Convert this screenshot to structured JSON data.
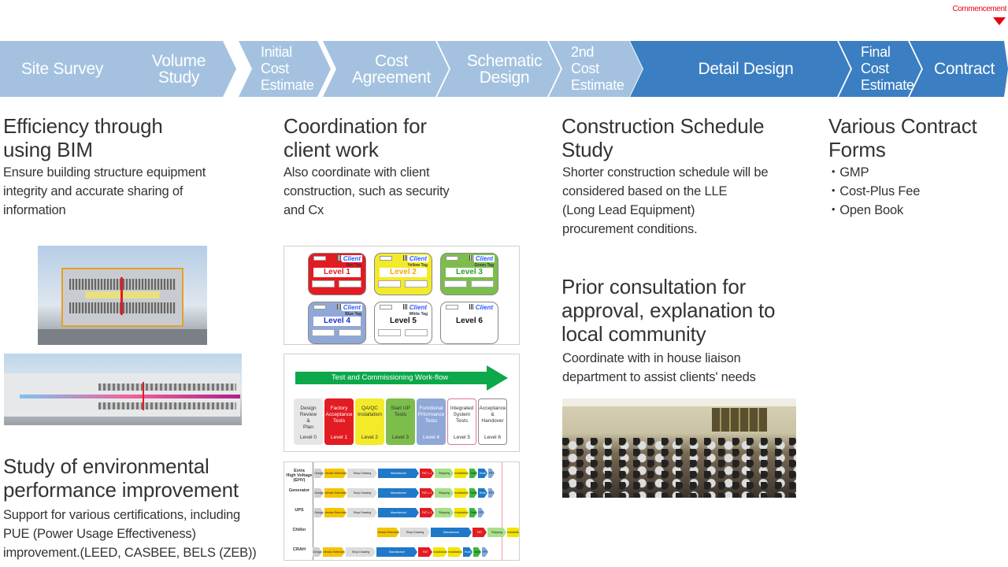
{
  "milestone": {
    "label": "Commencement",
    "color": "#e60012"
  },
  "colors": {
    "phase_light": "#a4c2e0",
    "phase_dark": "#3b7ec2"
  },
  "phases": [
    {
      "label": "Site Survey",
      "active": false
    },
    {
      "label": "Volume\nStudy",
      "active": false
    },
    {
      "label": "Initial\nCost\nEstimate",
      "active": false
    },
    {
      "label": "Cost\nAgreement",
      "active": false
    },
    {
      "label": "Schematic\nDesign",
      "active": false
    },
    {
      "label": "2nd\nCost\nEstimate",
      "active": false
    },
    {
      "label": "Detail Design",
      "active": true
    },
    {
      "label": "Final\nCost\nEstimate",
      "active": true
    },
    {
      "label": "Contract",
      "active": true
    }
  ],
  "sections": {
    "bim": {
      "title": "Efficiency through\nusing BIM",
      "body": "Ensure building structure equipment\nintegrity and accurate sharing of\ninformation"
    },
    "env": {
      "title": "Study of environmental\nperformance improvement",
      "body": "Support for various certifications, including\nPUE (Power Usage Effectiveness)\nimprovement.(LEED, CASBEE, BELS (ZEB))"
    },
    "client": {
      "title": "Coordination for\nclient work",
      "body": "Also coordinate with client\nconstruction,  such as security\nand Cx"
    },
    "schedule": {
      "title": "Construction Schedule\nStudy",
      "body": "Shorter construction schedule will be\n considered based on the LLE\n(Long Lead Equipment)\nprocurement conditions."
    },
    "community": {
      "title": "Prior consultation for\napproval, explanation to\nlocal community",
      "body": "Coordinate with in house liaison\ndepartment  to assist clients' needs"
    },
    "contract": {
      "title": "Various Contract\nForms",
      "items": [
        "・GMP",
        "・Cost-Plus Fee",
        "・Open Book"
      ]
    }
  },
  "tags": [
    {
      "level": "Level 1",
      "type": "Red Tag",
      "bg": "#e31b23",
      "text": "#e31b23"
    },
    {
      "level": "Level 2",
      "type": "Yellow Tag",
      "bg": "#f3ea2a",
      "text": "#f5a800"
    },
    {
      "level": "Level 3",
      "type": "Green Tag",
      "bg": "#7cbd4c",
      "text": "#2ca02c"
    },
    {
      "level": "Level 4",
      "type": "Blue Tag",
      "bg": "#8fa8d8",
      "text": "#1a2fe0"
    },
    {
      "level": "Level 5",
      "type": "White Tag",
      "bg": "#ffffff",
      "text": "#111111"
    },
    {
      "level": "Level 6",
      "type": "",
      "bg": "#ffffff",
      "text": "#111111"
    }
  ],
  "tag_client_label": "Client",
  "workflow": {
    "title": "Test and Commissioning Work-flow",
    "steps": [
      {
        "label": "Design\nReview\n&\nPlan",
        "level": "Level 0",
        "bg": "#e6e6e6",
        "fg": "#333",
        "border": "#e6e6e6"
      },
      {
        "label": "Factory\nAcceptance\nTests",
        "level": "Level 1",
        "bg": "#e31b23",
        "fg": "#fff",
        "border": "#e31b23"
      },
      {
        "label": "QA/QC\nInstallation",
        "level": "Level 2",
        "bg": "#f3ea2a",
        "fg": "#333",
        "border": "#f3ea2a"
      },
      {
        "label": "Start UP\nTests",
        "level": "Level 3",
        "bg": "#7cbd4c",
        "fg": "#333",
        "border": "#7cbd4c"
      },
      {
        "label": "Functional\nPrformance\nTests",
        "level": "Level 4",
        "bg": "#8fa8d8",
        "fg": "#fff",
        "border": "#8fa8d8"
      },
      {
        "label": "Integrated\nSystem\nTests",
        "level": "Level 5",
        "bg": "#ffffff",
        "fg": "#333",
        "border": "#e8709a"
      },
      {
        "label": "Acceptance\n&\nHandover",
        "level": "Level 6",
        "bg": "#ffffff",
        "fg": "#333",
        "border": "#888"
      }
    ]
  },
  "gantt": {
    "rows": [
      {
        "name": "Extra\nHigh Voltage\n(EHV)",
        "bars": [
          "Design L-0",
          "Vendor Selection",
          "Shop Drawing",
          "Manufacture",
          "FAT L-1",
          "Shipping",
          "Installation L-2",
          "Start up",
          "Hook Up",
          "FPT"
        ]
      },
      {
        "name": "Generator",
        "bars": [
          "Design L-0",
          "Vendor Selection",
          "Shop Drawing",
          "Manufacture",
          "FAT L-1",
          "Shipping",
          "Installation L-2",
          "Start up",
          "Hook Up",
          "FPT"
        ]
      },
      {
        "name": "UPS",
        "bars": [
          "Design L-0",
          "Vendor Selection",
          "Shop Drawing",
          "Manufacture",
          "FAT L-1",
          "Shipping",
          "Installation L-2",
          "Start up",
          "FPT"
        ]
      },
      {
        "name": "Chiller",
        "bars": [
          "Vendor Selection",
          "Shop Drawing",
          "Manufacture",
          "FAT",
          "Shipping",
          "Installation L-2",
          "Hook Up",
          "Start up",
          "FPT"
        ]
      },
      {
        "name": "CRAH",
        "bars": [
          "Design",
          "Vendor Selection",
          "Shop Drawing",
          "Manufacture",
          "FAT",
          "Installation",
          "Installation L-2",
          "Hook Up",
          "Start up",
          "FPT"
        ]
      }
    ],
    "bar_colors": {
      "Design": "#cfcfcf",
      "Vendor": "#f5c400",
      "Shop": "#dcdcdc",
      "Manufacture": "#1f78c8",
      "FAT": "#e31b23",
      "Shipping": "#a8e08c",
      "Installation": "#f5e400",
      "Hook": "#1f78c8",
      "Start": "#3cb83c",
      "FPT": "#7fa8e0"
    }
  }
}
